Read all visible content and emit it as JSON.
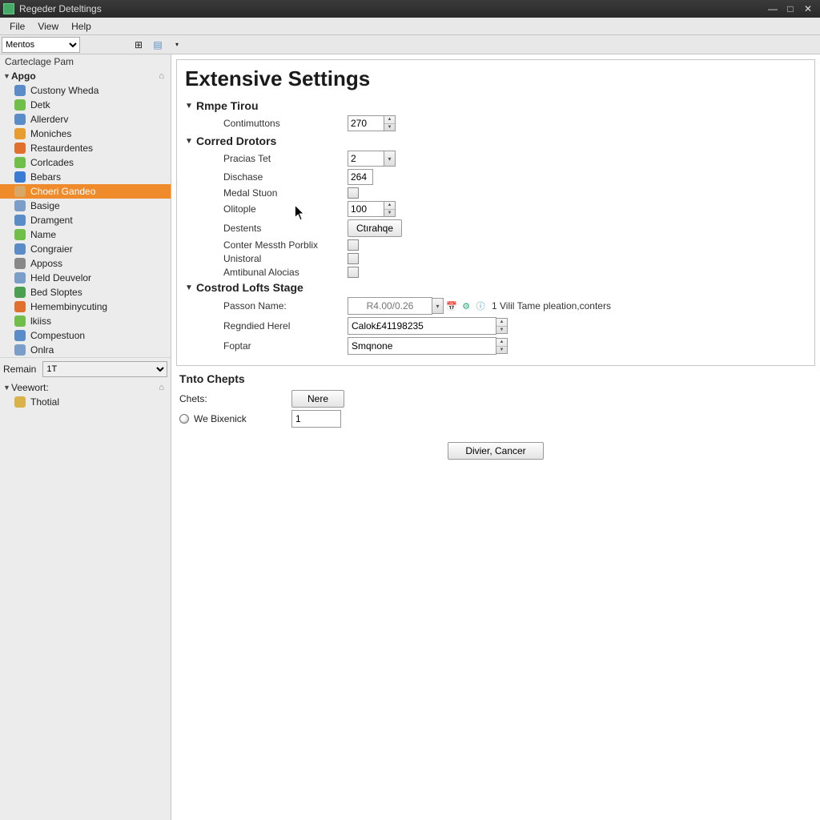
{
  "window": {
    "title": "Regeder Deteltings"
  },
  "menu": {
    "file": "File",
    "view": "View",
    "help": "Help"
  },
  "toolbar": {
    "selector_value": "Mentos"
  },
  "sidebar": {
    "pane_header": "Carteclage Pam",
    "group1_label": "Apgo",
    "items": [
      {
        "label": "Custony Wheda",
        "color": "#5a8cc7"
      },
      {
        "label": "Detk",
        "color": "#6fbf4a"
      },
      {
        "label": "Allerderv",
        "color": "#5a8cc7"
      },
      {
        "label": "Moniches",
        "color": "#e69c2e"
      },
      {
        "label": "Restaurdentes",
        "color": "#e0702e"
      },
      {
        "label": "Corlcades",
        "color": "#6fbf4a"
      },
      {
        "label": "Bebars",
        "color": "#3a7bd5"
      },
      {
        "label": "Choeri Gandeo",
        "color": "#d9a866",
        "selected": true
      },
      {
        "label": "Basige",
        "color": "#7a9ec7"
      },
      {
        "label": "Dramgent",
        "color": "#5a8cc7"
      },
      {
        "label": "Name",
        "color": "#6fbf4a"
      },
      {
        "label": "Congraier",
        "color": "#5a8cc7"
      },
      {
        "label": "Apposs",
        "color": "#888"
      },
      {
        "label": "Held Deuvelor",
        "color": "#7a9ec7"
      },
      {
        "label": "Bed Sloptes",
        "color": "#4aa050"
      },
      {
        "label": "Hemembinycuting",
        "color": "#e0702e"
      },
      {
        "label": "lkiiss",
        "color": "#6fbf4a"
      },
      {
        "label": "Compestuon",
        "color": "#5a8cc7"
      },
      {
        "label": "Onlra",
        "color": "#7a9ec7"
      }
    ],
    "remain_label": "Remain",
    "remain_value": "1T",
    "group2_label": "Veewort:",
    "group2_items": [
      {
        "label": "Thotial",
        "color": "#d9b24a"
      }
    ]
  },
  "page": {
    "title": "Extensive Settings",
    "section1": {
      "title": "Rmpe Tirou",
      "fields": {
        "contimuttons_label": "Contimuttons",
        "contimuttons_value": "270"
      }
    },
    "section2": {
      "title": "Corred Drotors",
      "pracias_label": "Pracias Tet",
      "pracias_value": "2",
      "dischase_label": "Dischase",
      "dischase_value": "264",
      "medal_label": "Medal Stuon",
      "olitople_label": "Olitople",
      "olitople_value": "100",
      "destents_label": "Destents",
      "destents_btn": "Ctırahqe",
      "conter_label": "Conter Messth Porblix",
      "unistoral_label": "Unistoral",
      "amtibunal_label": "Amtibunal Alocias"
    },
    "section3": {
      "title": "Costrod Lofts Stage",
      "passon_label": "Passon Name:",
      "passon_placeholder": "R4.00/0.26",
      "passon_help": "1 Vilil Tame pleation,conters",
      "regnd_label": "Regndied Herel",
      "regnd_value": "Calok£41198235",
      "foptar_label": "Foptar",
      "foptar_value": "Smqnone"
    }
  },
  "lower": {
    "title": "Tnto Chepts",
    "chets_label": "Chets:",
    "nere_btn": "Nere",
    "radio_label": "We Bixenick",
    "radio_value": "1"
  },
  "footer": {
    "cancel_btn": "Divier, Cancer"
  }
}
